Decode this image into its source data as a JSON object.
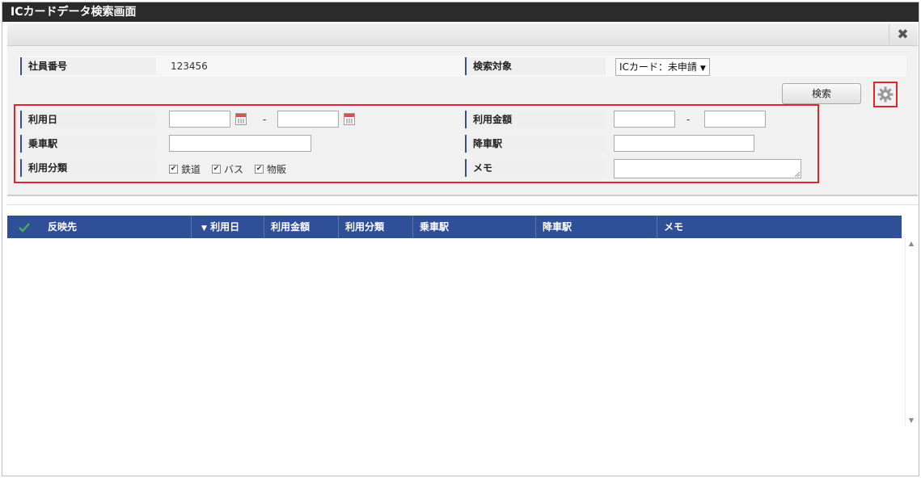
{
  "window": {
    "title": "ICカードデータ検索画面"
  },
  "toolbar": {
    "close_icon": "close-icon"
  },
  "form": {
    "employee_no_label": "社員番号",
    "employee_no_value": "123456",
    "search_target_label": "検索対象",
    "search_target_value": "ICカード：未申請",
    "search_button": "検索",
    "use_date_label": "利用日",
    "use_date_from": "",
    "use_date_to": "",
    "date_separator": "-",
    "amount_label": "利用金額",
    "amount_from": "",
    "amount_to": "",
    "amount_separator": "-",
    "board_station_label": "乗車駅",
    "board_station_value": "",
    "alight_station_label": "降車駅",
    "alight_station_value": "",
    "category_label": "利用分類",
    "categories": [
      {
        "label": "鉄道",
        "checked": true
      },
      {
        "label": "バス",
        "checked": true
      },
      {
        "label": "物販",
        "checked": true
      }
    ],
    "memo_label": "メモ",
    "memo_value": ""
  },
  "grid": {
    "columns": [
      "反映先",
      "利用日",
      "利用金額",
      "利用分類",
      "乗車駅",
      "降車駅",
      "メモ"
    ],
    "sort_indicator": "▼",
    "check_icon": "check-icon"
  },
  "colors": {
    "titlebar": "#2b2b2b",
    "grid_header": "#2f4f98",
    "highlight": "#e0252b",
    "check": "#4caf50"
  }
}
